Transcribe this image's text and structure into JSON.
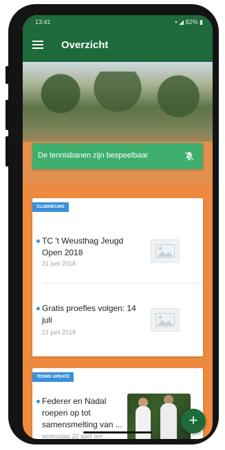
{
  "status_bar": {
    "time": "13:41",
    "battery": "82%"
  },
  "app_bar": {
    "title": "Overzicht"
  },
  "banner": {
    "text": "De tennisbanen zijn bespeelbaar"
  },
  "clubnieuws": {
    "tag": "CLUBNIEUWS",
    "items": [
      {
        "title": "TC 't Weusthag Jeugd Open 2018",
        "date": "21 juni 2018"
      },
      {
        "title": "Gratis proefles volgen: 14 juli",
        "date": "21 juni 2018"
      }
    ]
  },
  "tennis_update": {
    "tag": "TENNIS UPDATE",
    "items": [
      {
        "title": "Federer en Nadal roepen op tot samensmelting van ...",
        "date": "woensdag 22 april om ..."
      }
    ]
  },
  "fab": {
    "label": "+"
  },
  "colors": {
    "primary": "#1e6a3a",
    "banner": "#3faf6e",
    "tag": "#3b8fd9",
    "court": "#ed8a3f"
  }
}
